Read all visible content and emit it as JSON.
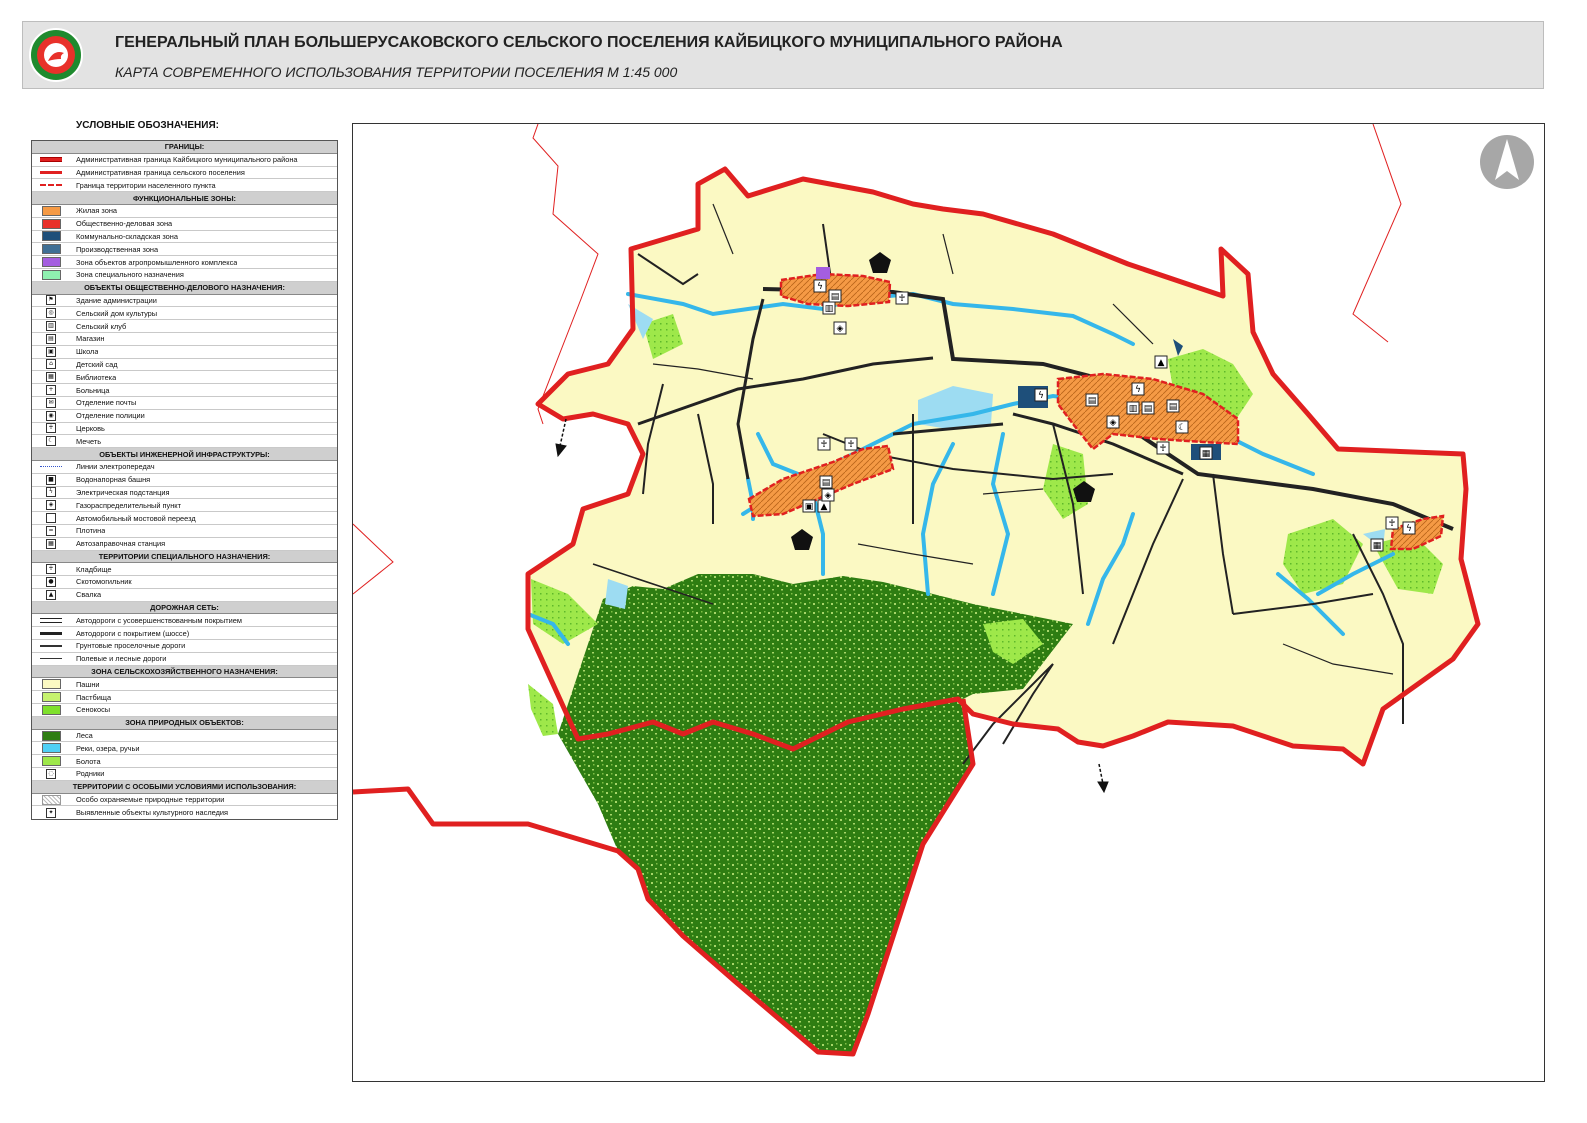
{
  "header": {
    "title": "ГЕНЕРАЛЬНЫЙ ПЛАН БОЛЬШЕРУСАКОВСКОГО СЕЛЬСКОГО ПОСЕЛЕНИЯ КАЙБИЦКОГО МУНИЦИПАЛЬНОГО РАЙОНА",
    "subtitle": "КАРТА СОВРЕМЕННОГО ИСПОЛЬЗОВАНИЯ ТЕРРИТОРИИ ПОСЕЛЕНИЯ М 1:45 000"
  },
  "legend": {
    "title": "УСЛОВНЫЕ ОБОЗНАЧЕНИЯ:",
    "sections": [
      {
        "heading": "ГРАНИЦЫ:",
        "items": [
          {
            "label": "Административная граница Кайбицкого муниципального района",
            "symbol": "line-red-double"
          },
          {
            "label": "Административная граница сельского поселения",
            "symbol": "line-red"
          },
          {
            "label": "Граница территории населенного пункта",
            "symbol": "line-red-dash"
          }
        ]
      },
      {
        "heading": "ФУНКЦИОНАЛЬНЫЕ ЗОНЫ:",
        "items": [
          {
            "label": "Жилая зона",
            "symbol": "fill",
            "color": "#f59a45"
          },
          {
            "label": "Общественно-деловая зона",
            "symbol": "fill",
            "color": "#e8312a"
          },
          {
            "label": "Коммунально-складская зона",
            "symbol": "fill",
            "color": "#1e4f7a"
          },
          {
            "label": "Производственная зона",
            "symbol": "fill",
            "color": "#3f6f95"
          },
          {
            "label": "Зона объектов агропромышленного комплекса",
            "symbol": "fill",
            "color": "#a45ee0"
          },
          {
            "label": "Зона специального назначения",
            "symbol": "fill",
            "color": "#8ff0b0"
          }
        ]
      },
      {
        "heading": "ОБЪЕКТЫ ОБЩЕСТВЕННО-ДЕЛОВОГО НАЗНАЧЕНИЯ:",
        "items": [
          {
            "label": "Здание администрации",
            "symbol": "icon",
            "icon": "flag-icon"
          },
          {
            "label": "Сельский дом культуры",
            "symbol": "icon",
            "icon": "theatre-icon"
          },
          {
            "label": "Сельский клуб",
            "symbol": "icon",
            "icon": "club-icon"
          },
          {
            "label": "Магазин",
            "symbol": "icon",
            "icon": "shop-icon"
          },
          {
            "label": "Школа",
            "symbol": "icon",
            "icon": "school-icon"
          },
          {
            "label": "Детский сад",
            "symbol": "icon",
            "icon": "kindergarten-icon"
          },
          {
            "label": "Библиотека",
            "symbol": "icon",
            "icon": "library-icon"
          },
          {
            "label": "Больница",
            "symbol": "icon",
            "icon": "hospital-icon"
          },
          {
            "label": "Отделение почты",
            "symbol": "icon",
            "icon": "post-icon"
          },
          {
            "label": "Отделение полиции",
            "symbol": "icon",
            "icon": "police-icon"
          },
          {
            "label": "Церковь",
            "symbol": "icon",
            "icon": "church-icon"
          },
          {
            "label": "Мечеть",
            "symbol": "icon",
            "icon": "mosque-icon"
          }
        ]
      },
      {
        "heading": "ОБЪЕКТЫ ИНЖЕНЕРНОЙ ИНФРАСТРУКТУРЫ:",
        "items": [
          {
            "label": "Линии электропередач",
            "symbol": "line-power"
          },
          {
            "label": "Водонапорная башня",
            "symbol": "icon",
            "icon": "water-tower-icon"
          },
          {
            "label": "Электрическая подстанция",
            "symbol": "icon",
            "icon": "substation-icon"
          },
          {
            "label": "Газораспределительный пункт",
            "symbol": "icon",
            "icon": "gas-icon"
          },
          {
            "label": "Автомобильный мостовой переезд",
            "symbol": "icon",
            "icon": "bridge-icon"
          },
          {
            "label": "Плотина",
            "symbol": "icon",
            "icon": "dam-icon"
          },
          {
            "label": "Автозаправочная станция",
            "symbol": "icon",
            "icon": "fuel-icon"
          }
        ]
      },
      {
        "heading": "ТЕРРИТОРИИ СПЕЦИАЛЬНОГО НАЗНАЧЕНИЯ:",
        "items": [
          {
            "label": "Кладбище",
            "symbol": "icon",
            "icon": "cemetery-icon"
          },
          {
            "label": "Скотомогильник",
            "symbol": "icon",
            "icon": "cattle-burial-icon"
          },
          {
            "label": "Свалка",
            "symbol": "icon",
            "icon": "landfill-icon"
          }
        ]
      },
      {
        "heading": "ДОРОЖНАЯ СЕТЬ:",
        "items": [
          {
            "label": "Автодороги с усовершенствованным покрытием",
            "symbol": "road-improved"
          },
          {
            "label": "Автодороги с покрытием (шоссе)",
            "symbol": "road-paved"
          },
          {
            "label": "Грунтовые проселочные дороги",
            "symbol": "road-dirt"
          },
          {
            "label": "Полевые и лесные дороги",
            "symbol": "road-field"
          }
        ]
      },
      {
        "heading": "ЗОНА СЕЛЬСКОХОЗЯЙСТВЕННОГО НАЗНАЧЕНИЯ:",
        "items": [
          {
            "label": "Пашни",
            "symbol": "fill",
            "color": "#fbf9c3"
          },
          {
            "label": "Пастбища",
            "symbol": "fill",
            "color": "#c6f26e"
          },
          {
            "label": "Сенокосы",
            "symbol": "fill",
            "color": "#7fe02c"
          }
        ]
      },
      {
        "heading": "ЗОНА ПРИРОДНЫХ ОБЪЕКТОВ:",
        "items": [
          {
            "label": "Леса",
            "symbol": "fill",
            "color": "#2e7d12"
          },
          {
            "label": "Реки, озера, ручьи",
            "symbol": "fill",
            "color": "#4fd0f5"
          },
          {
            "label": "Болота",
            "symbol": "fill",
            "color": "#9ee84a"
          },
          {
            "label": "Родники",
            "symbol": "icon",
            "icon": "spring-icon"
          }
        ]
      },
      {
        "heading": "ТЕРРИТОРИИ С ОСОБЫМИ УСЛОВИЯМИ ИСПОЛЬЗОВАНИЯ:",
        "items": [
          {
            "label": "Особо охраняемые природные территории",
            "symbol": "hatch"
          },
          {
            "label": "Выявленные объекты культурного наследия",
            "symbol": "icon",
            "icon": "heritage-icon"
          }
        ]
      }
    ]
  },
  "map": {
    "colors": {
      "farmland": "#fbf9c3",
      "forest": "#2e7d12",
      "forest_texture": "#a8d66a",
      "water": "#35b7ea",
      "lake": "#9ddcf2",
      "meadow": "#9ee84a",
      "residential": "#f59a45",
      "boundary": "#e02020",
      "road": "#222222",
      "industrial": "#1e4f7a"
    },
    "north_arrow": "north-arrow-icon"
  }
}
